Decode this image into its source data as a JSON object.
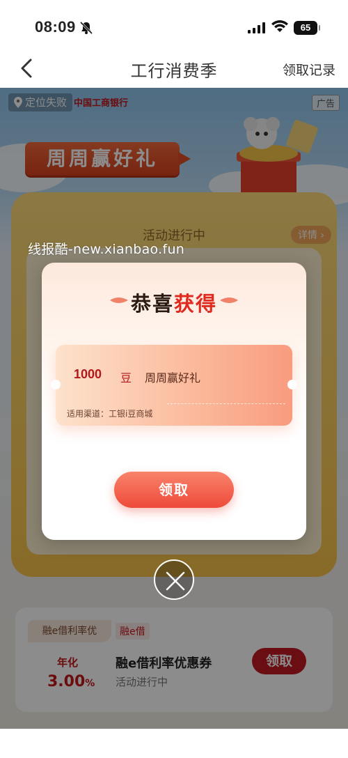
{
  "status_bar": {
    "time": "08:09",
    "battery": "65"
  },
  "nav": {
    "title": "工行消费季",
    "record_label": "领取记录"
  },
  "page": {
    "location_label": "定位失败",
    "bank_name": "中国工商银行",
    "ad_label": "广告",
    "banner_title": "周周赢好礼",
    "activity_status": "活动进行中",
    "detail_label": "详情 ›"
  },
  "coupon": {
    "tag_promo": "融e借利率优",
    "tag_product": "融e借",
    "rate_label": "年化",
    "rate_value": "3.00",
    "rate_unit": "%",
    "title": "融e借利率优惠券",
    "subtitle": "活动进行中",
    "claim_label": "领取"
  },
  "watermark": "线报酷-new.xianbao.fun",
  "modal": {
    "title_part1": "恭喜",
    "title_part2": "获得",
    "amount": "1000",
    "unit": "豆",
    "reward_name": "周周赢好礼",
    "channel": "适用渠道：工银i豆商城",
    "claim_label": "领取"
  },
  "icons": [
    "bell-slash-icon",
    "signal-icon",
    "wifi-icon",
    "back-chevron-icon",
    "location-pin-icon",
    "close-icon"
  ],
  "colors": {
    "accent_red": "#c4161c",
    "modal_button": "#ee4a3a",
    "banner": "#e04d24"
  }
}
